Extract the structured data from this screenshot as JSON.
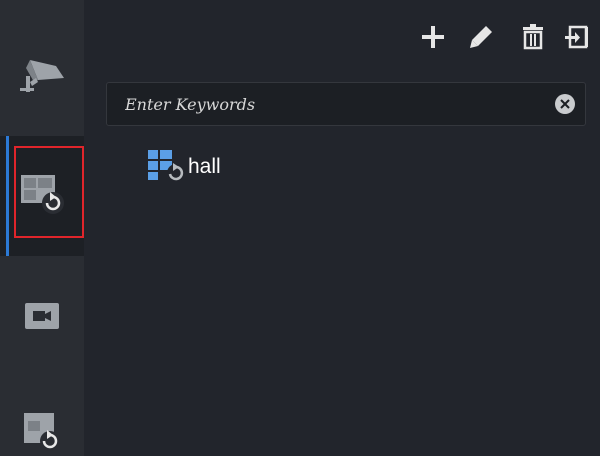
{
  "toolbar": {
    "icons": [
      "plus-icon",
      "pencil-icon",
      "trash-icon",
      "import-icon"
    ]
  },
  "sidebar": {
    "items": [
      {
        "name": "camera-surveillance",
        "icon": "cctv-camera-icon"
      },
      {
        "name": "view-loop",
        "icon": "window-refresh-icon",
        "active": true
      },
      {
        "name": "video",
        "icon": "video-camera-icon"
      },
      {
        "name": "window-refresh",
        "icon": "window-refresh-icon"
      }
    ]
  },
  "search": {
    "placeholder": "Enter Keywords",
    "value": ""
  },
  "tree": {
    "items": [
      {
        "label": "hall",
        "icon": "view-group-icon"
      }
    ]
  },
  "colors": {
    "accent": "#2c7ad6",
    "highlight": "#e0252b",
    "background": "#22252c",
    "sidebar": "#2a2d33"
  }
}
